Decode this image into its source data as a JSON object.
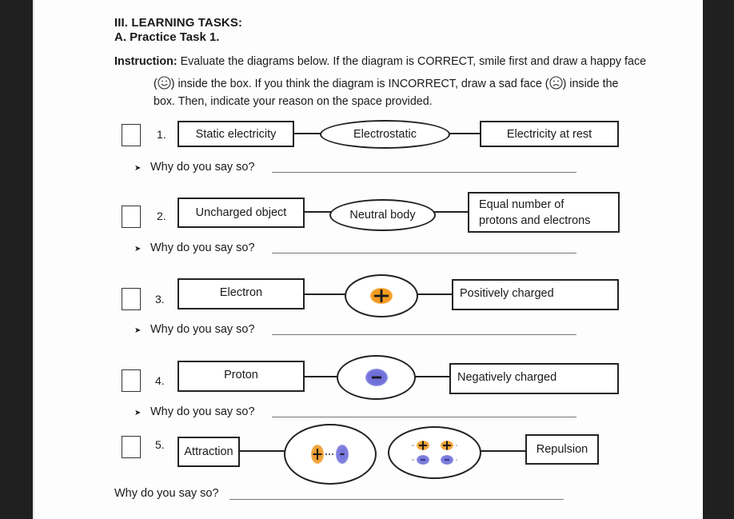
{
  "heading": "III. LEARNING TASKS:",
  "subheading": "A. Practice Task 1.",
  "instruction": {
    "label": "Instruction:",
    "line1": " Evaluate the diagrams below. If the diagram is CORRECT, smile first and draw a happy face",
    "line2_a": "(",
    "line2_b": ") inside the box. If you think the diagram is INCORRECT, draw a sad face (",
    "line2_c": ") inside the",
    "line3": "box. Then, indicate your reason on the space provided.",
    "happy_icon": "happy-face-icon",
    "sad_icon": "sad-face-icon"
  },
  "why_prompt": "Why do you say so?",
  "bullet_icon": "arrow-bullet-icon",
  "items": [
    {
      "number": "1.",
      "left": "Static electricity",
      "middle": "Electrostatic",
      "right": "Electricity at rest"
    },
    {
      "number": "2.",
      "left": "Uncharged object",
      "middle": "Neutral body",
      "right_line1": "Equal number of",
      "right_line2": "protons and electrons"
    },
    {
      "number": "3.",
      "left": "Electron",
      "middle_icon": "positive-charge-icon",
      "middle_symbol": "+",
      "right": "Positively charged"
    },
    {
      "number": "4.",
      "left": "Proton",
      "middle_icon": "negative-charge-icon",
      "middle_symbol": "−",
      "right": "Negatively charged"
    },
    {
      "number": "5.",
      "left": "Attraction",
      "middle_left_icon": "attraction-charges-icon",
      "middle_right_icon": "repulsion-charges-icon",
      "right": "Repulsion"
    }
  ],
  "colors": {
    "positive": "#f39a1e",
    "negative": "#6f6fd8",
    "ink": "#222222",
    "background": "#202020"
  }
}
